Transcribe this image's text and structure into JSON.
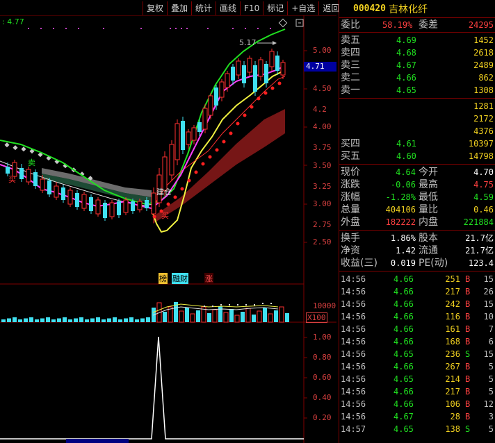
{
  "toolbar": [
    "复权",
    "叠加",
    "统计",
    "画线",
    "F10",
    "标记",
    "+自选",
    "返回"
  ],
  "chart": {
    "top_left_value": ": 4.77",
    "peak_label": "5.17",
    "current_price_tag": "4.71",
    "y_labels": [
      "5.00",
      "4.50",
      "4.2",
      "4.00",
      "3.75",
      "3.50",
      "3.25",
      "3.00",
      "2.75",
      "2.50"
    ],
    "annotations": {
      "buy_left": "买",
      "sell_left": "卖",
      "build_pos": "建仓",
      "buy_bottom": "买"
    },
    "tags": [
      "榜",
      "融财",
      "涨"
    ],
    "volume_label": "10000",
    "volume_unit": "X100",
    "ind_labels": [
      "1.00",
      "0.80",
      "0.60",
      "0.40",
      "0.20"
    ]
  },
  "quote": {
    "code": "000420",
    "name": "吉林化纤",
    "weibi_label": "委比",
    "weibi_value": "58.19%",
    "weicha_label": "委差",
    "weicha_value": "24295",
    "asks": [
      {
        "label": "卖五",
        "price": "4.69",
        "vol": "1452"
      },
      {
        "label": "卖四",
        "price": "4.68",
        "vol": "2618"
      },
      {
        "label": "卖三",
        "price": "4.67",
        "vol": "2489"
      },
      {
        "label": "卖二",
        "price": "4.66",
        "vol": "862"
      },
      {
        "label": "卖一",
        "price": "4.65",
        "vol": "1308"
      }
    ],
    "bid_vols_partial": [
      "1281",
      "2172",
      "4376"
    ],
    "bids_visible": [
      {
        "label": "买四",
        "price": "4.61",
        "vol": "10397"
      },
      {
        "label": "买五",
        "price": "4.60",
        "vol": "14798"
      }
    ],
    "stats": [
      {
        "l1": "现价",
        "v1": "4.64",
        "c1": "green",
        "l2": "今开",
        "v2": "4.70",
        "c2": "white"
      },
      {
        "l1": "涨跌",
        "v1": "-0.06",
        "c1": "green",
        "l2": "最高",
        "v2": "4.75",
        "c2": "red"
      },
      {
        "l1": "涨幅",
        "v1": "-1.28%",
        "c1": "green",
        "l2": "最低",
        "v2": "4.59",
        "c2": "green"
      },
      {
        "l1": "总量",
        "v1": "404106",
        "c1": "yellow",
        "l2": "量比",
        "v2": "0.46",
        "c2": "yellow"
      },
      {
        "l1": "外盘",
        "v1": "182222",
        "c1": "red",
        "l2": "内盘",
        "v2": "221884",
        "c2": "green"
      }
    ],
    "fund": [
      {
        "l1": "换手",
        "v1": "1.86%",
        "l2": "股本",
        "v2": "21.7亿"
      },
      {
        "l1": "净资",
        "v1": "1.42",
        "l2": "流通",
        "v2": "21.7亿"
      },
      {
        "l1": "收益(三)",
        "v1": "0.019",
        "l2": "PE(动)",
        "v2": "123.4"
      }
    ],
    "trades": [
      {
        "t": "14:56",
        "p": "4.66",
        "v": "251",
        "d": "B",
        "n": "15"
      },
      {
        "t": "14:56",
        "p": "4.66",
        "v": "217",
        "d": "B",
        "n": "26"
      },
      {
        "t": "14:56",
        "p": "4.66",
        "v": "242",
        "d": "B",
        "n": "15"
      },
      {
        "t": "14:56",
        "p": "4.66",
        "v": "116",
        "d": "B",
        "n": "10"
      },
      {
        "t": "14:56",
        "p": "4.66",
        "v": "161",
        "d": "B",
        "n": "7"
      },
      {
        "t": "14:56",
        "p": "4.66",
        "v": "168",
        "d": "B",
        "n": "6"
      },
      {
        "t": "14:56",
        "p": "4.65",
        "v": "236",
        "d": "S",
        "n": "15"
      },
      {
        "t": "14:56",
        "p": "4.66",
        "v": "267",
        "d": "B",
        "n": "5"
      },
      {
        "t": "14:56",
        "p": "4.65",
        "v": "214",
        "d": "B",
        "n": "5"
      },
      {
        "t": "14:56",
        "p": "4.66",
        "v": "217",
        "d": "B",
        "n": "5"
      },
      {
        "t": "14:56",
        "p": "4.66",
        "v": "106",
        "d": "B",
        "n": "12"
      },
      {
        "t": "14:56",
        "p": "4.67",
        "v": "28",
        "d": "B",
        "n": "3"
      },
      {
        "t": "14:57",
        "p": "4.65",
        "v": "138",
        "d": "S",
        "n": "5"
      }
    ]
  },
  "colors": {
    "up": "#ff4040",
    "down": "#20e020",
    "candle_up": "#ff3030",
    "candle_down": "#40e0f0",
    "frame": "#800000"
  }
}
